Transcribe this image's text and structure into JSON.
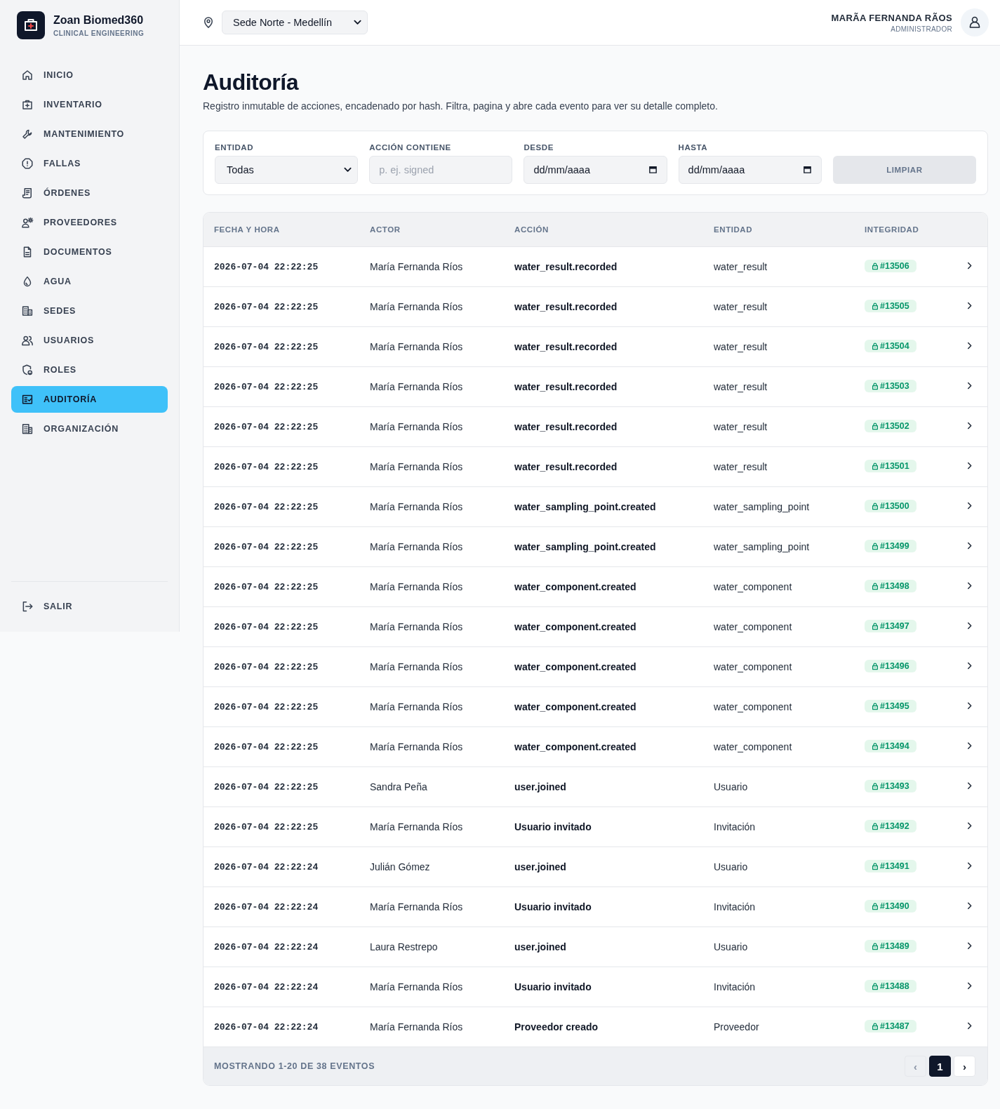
{
  "sidebar": {
    "brand": {
      "name": "Zoan Biomed360",
      "tagline": "CLINICAL ENGINEERING"
    },
    "items": [
      {
        "label": "INICIO",
        "selected": false
      },
      {
        "label": "INVENTARIO",
        "selected": false
      },
      {
        "label": "MANTENIMIENTO",
        "selected": false
      },
      {
        "label": "FALLAS",
        "selected": false
      },
      {
        "label": "ÓRDENES",
        "selected": false
      },
      {
        "label": "PROVEEDORES",
        "selected": false
      },
      {
        "label": "DOCUMENTOS",
        "selected": false
      },
      {
        "label": "AGUA",
        "selected": false
      },
      {
        "label": "SEDES",
        "selected": false
      },
      {
        "label": "USUARIOS",
        "selected": false
      },
      {
        "label": "ROLES",
        "selected": false
      },
      {
        "label": "AUDITORÍA",
        "selected": true
      },
      {
        "label": "ORGANIZACIÓN",
        "selected": false
      }
    ],
    "logout": {
      "label": "SALIR"
    }
  },
  "top_bar": {
    "site_select": {
      "value": "Sede Norte - Medellín"
    },
    "user": {
      "name": "MARÃA FERNANDA RÃOS",
      "role": "ADMINISTRADOR"
    }
  },
  "page": {
    "title": "Auditoría",
    "description": "Registro inmutable de acciones, encadenado por hash. Filtra, pagina y abre cada evento para ver su detalle completo."
  },
  "filters": [
    {
      "kind": "select",
      "label": "ENTIDAD",
      "value": "Todas"
    },
    {
      "kind": "text",
      "label": "ACCIÓN CONTIENE",
      "placeholder": "p. ej. signed"
    },
    {
      "kind": "date",
      "label": "DESDE",
      "placeholder": "dd/mm/aaaa"
    },
    {
      "kind": "date",
      "label": "HASTA",
      "placeholder": "dd/mm/aaaa"
    },
    {
      "kind": "button",
      "label": "LIMPIAR",
      "disabled": true
    }
  ],
  "table": {
    "columns": [
      "FECHA Y HORA",
      "ACTOR",
      "ACCIÓN",
      "ENTIDAD",
      "INTEGRIDAD"
    ],
    "rows": [
      {
        "timestamp": "2026-07-04 22:22:25",
        "actor": "María Fernanda Ríos",
        "action": "water_result.recorded",
        "entity": "water_result",
        "integrity": "#13506"
      },
      {
        "timestamp": "2026-07-04 22:22:25",
        "actor": "María Fernanda Ríos",
        "action": "water_result.recorded",
        "entity": "water_result",
        "integrity": "#13505"
      },
      {
        "timestamp": "2026-07-04 22:22:25",
        "actor": "María Fernanda Ríos",
        "action": "water_result.recorded",
        "entity": "water_result",
        "integrity": "#13504"
      },
      {
        "timestamp": "2026-07-04 22:22:25",
        "actor": "María Fernanda Ríos",
        "action": "water_result.recorded",
        "entity": "water_result",
        "integrity": "#13503"
      },
      {
        "timestamp": "2026-07-04 22:22:25",
        "actor": "María Fernanda Ríos",
        "action": "water_result.recorded",
        "entity": "water_result",
        "integrity": "#13502"
      },
      {
        "timestamp": "2026-07-04 22:22:25",
        "actor": "María Fernanda Ríos",
        "action": "water_result.recorded",
        "entity": "water_result",
        "integrity": "#13501"
      },
      {
        "timestamp": "2026-07-04 22:22:25",
        "actor": "María Fernanda Ríos",
        "action": "water_sampling_point.created",
        "entity": "water_sampling_point",
        "integrity": "#13500"
      },
      {
        "timestamp": "2026-07-04 22:22:25",
        "actor": "María Fernanda Ríos",
        "action": "water_sampling_point.created",
        "entity": "water_sampling_point",
        "integrity": "#13499"
      },
      {
        "timestamp": "2026-07-04 22:22:25",
        "actor": "María Fernanda Ríos",
        "action": "water_component.created",
        "entity": "water_component",
        "integrity": "#13498"
      },
      {
        "timestamp": "2026-07-04 22:22:25",
        "actor": "María Fernanda Ríos",
        "action": "water_component.created",
        "entity": "water_component",
        "integrity": "#13497"
      },
      {
        "timestamp": "2026-07-04 22:22:25",
        "actor": "María Fernanda Ríos",
        "action": "water_component.created",
        "entity": "water_component",
        "integrity": "#13496"
      },
      {
        "timestamp": "2026-07-04 22:22:25",
        "actor": "María Fernanda Ríos",
        "action": "water_component.created",
        "entity": "water_component",
        "integrity": "#13495"
      },
      {
        "timestamp": "2026-07-04 22:22:25",
        "actor": "María Fernanda Ríos",
        "action": "water_component.created",
        "entity": "water_component",
        "integrity": "#13494"
      },
      {
        "timestamp": "2026-07-04 22:22:25",
        "actor": "Sandra Peña",
        "action": "user.joined",
        "entity": "Usuario",
        "integrity": "#13493"
      },
      {
        "timestamp": "2026-07-04 22:22:25",
        "actor": "María Fernanda Ríos",
        "action": "Usuario invitado",
        "entity": "Invitación",
        "integrity": "#13492"
      },
      {
        "timestamp": "2026-07-04 22:22:24",
        "actor": "Julián Gómez",
        "action": "user.joined",
        "entity": "Usuario",
        "integrity": "#13491"
      },
      {
        "timestamp": "2026-07-04 22:22:24",
        "actor": "María Fernanda Ríos",
        "action": "Usuario invitado",
        "entity": "Invitación",
        "integrity": "#13490"
      },
      {
        "timestamp": "2026-07-04 22:22:24",
        "actor": "Laura Restrepo",
        "action": "user.joined",
        "entity": "Usuario",
        "integrity": "#13489"
      },
      {
        "timestamp": "2026-07-04 22:22:24",
        "actor": "María Fernanda Ríos",
        "action": "Usuario invitado",
        "entity": "Invitación",
        "integrity": "#13488"
      },
      {
        "timestamp": "2026-07-04 22:22:24",
        "actor": "María Fernanda Ríos",
        "action": "Proveedor creado",
        "entity": "Proveedor",
        "integrity": "#13487"
      }
    ],
    "summary": "MOSTRANDO 1-20 DE 38 EVENTOS",
    "pagination": {
      "prev": {
        "label": "‹",
        "disabled": true
      },
      "pages": [
        {
          "label": "1",
          "selected": true
        }
      ],
      "next": {
        "label": "›",
        "disabled": false
      }
    }
  }
}
